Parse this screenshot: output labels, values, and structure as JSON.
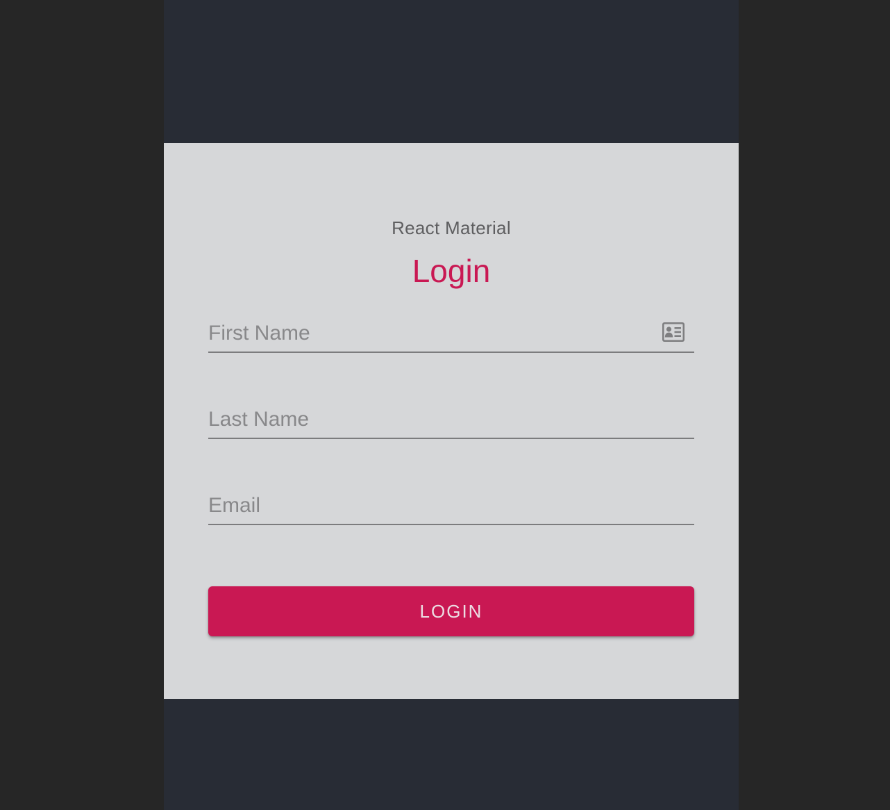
{
  "header": {
    "subtitle": "React Material",
    "title": "Login"
  },
  "form": {
    "first_name": {
      "placeholder": "First Name",
      "value": "",
      "icon": "contact-card-icon"
    },
    "last_name": {
      "placeholder": "Last Name",
      "value": ""
    },
    "email": {
      "placeholder": "Email",
      "value": ""
    }
  },
  "actions": {
    "login_label": "LOGIN"
  },
  "colors": {
    "accent": "#c91853",
    "page_background": "#282c35",
    "card_background": "#d6d7d9"
  }
}
